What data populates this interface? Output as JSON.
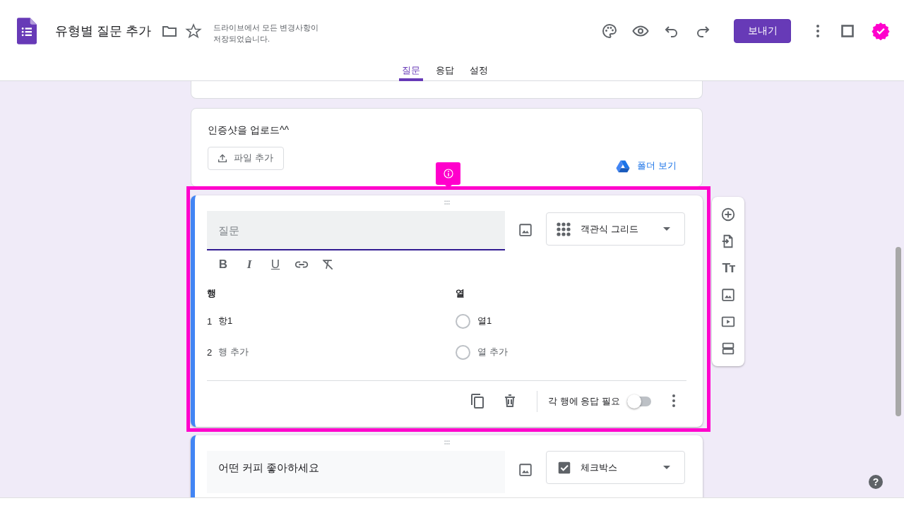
{
  "header": {
    "title": "유형별 질문 추가",
    "save_status": "드라이브에서 모든 변경사항이 저장되었습니다.",
    "send_button": "보내기"
  },
  "tabs": [
    {
      "label": "질문",
      "selected": true
    },
    {
      "label": "응답",
      "selected": false
    },
    {
      "label": "설정",
      "selected": false
    }
  ],
  "upload_question": {
    "title": "인증샷을 업로드^^",
    "add_file_button": "파일 추가",
    "folder_link": "폴더 보기"
  },
  "active_question": {
    "placeholder": "질문",
    "type": "객관식 그리드",
    "format_buttons": [
      "B",
      "I",
      "U"
    ],
    "rows_heading": "행",
    "rows": [
      {
        "number": "1",
        "label": "항1"
      }
    ],
    "add_row": {
      "number": "2",
      "label": "행 추가"
    },
    "columns_heading": "열",
    "columns": [
      {
        "label": "열1",
        "selected": false
      }
    ],
    "add_column": {
      "label": "열 추가",
      "selected": false
    },
    "required_label": "각 행에 응답 필요",
    "required": false
  },
  "side_toolbar": {
    "title_button": "Tт"
  },
  "next_question": {
    "title": "어떤 커피 좋아하세요",
    "type": "체크박스"
  },
  "help_button": "?"
}
